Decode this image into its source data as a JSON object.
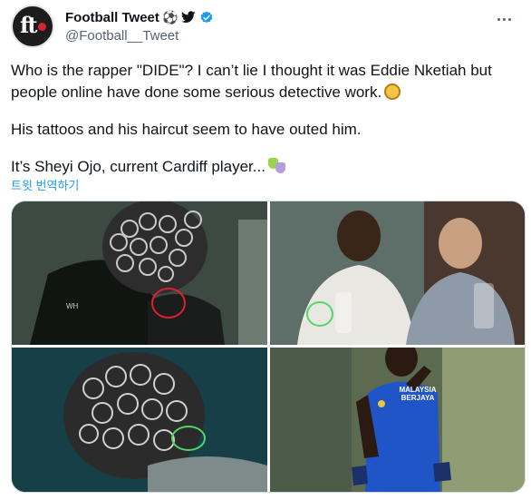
{
  "tweet": {
    "author": {
      "display_name": "Football Tweet",
      "handle": "@Football__Tweet",
      "avatar_text": "ft",
      "name_emojis": [
        "⚽",
        "🐦"
      ],
      "verified": true
    },
    "text": {
      "line1": "Who is the rapper \"DIDE\"? I can’t lie I thought it was Eddie Nketiah but people online have done some serious detective work.",
      "line2": "His tattoos and his haircut seem to have outed him.",
      "line3": "It’s Sheyi Ojo, current Cardiff player..."
    },
    "inline_icons": [
      "magnifier-icon",
      "masks-icon"
    ],
    "translate_label": "트윗 번역하기",
    "media": {
      "photo_count": 4,
      "jersey_text": "MALAYSIA BERJAYA"
    }
  },
  "colors": {
    "link": "#1d9bf0",
    "secondary_text": "#536471",
    "verified": "#1d9bf0",
    "highlight_red": "#e21f2a",
    "highlight_green": "#52d66a",
    "jersey_blue": "#1f55c6"
  }
}
